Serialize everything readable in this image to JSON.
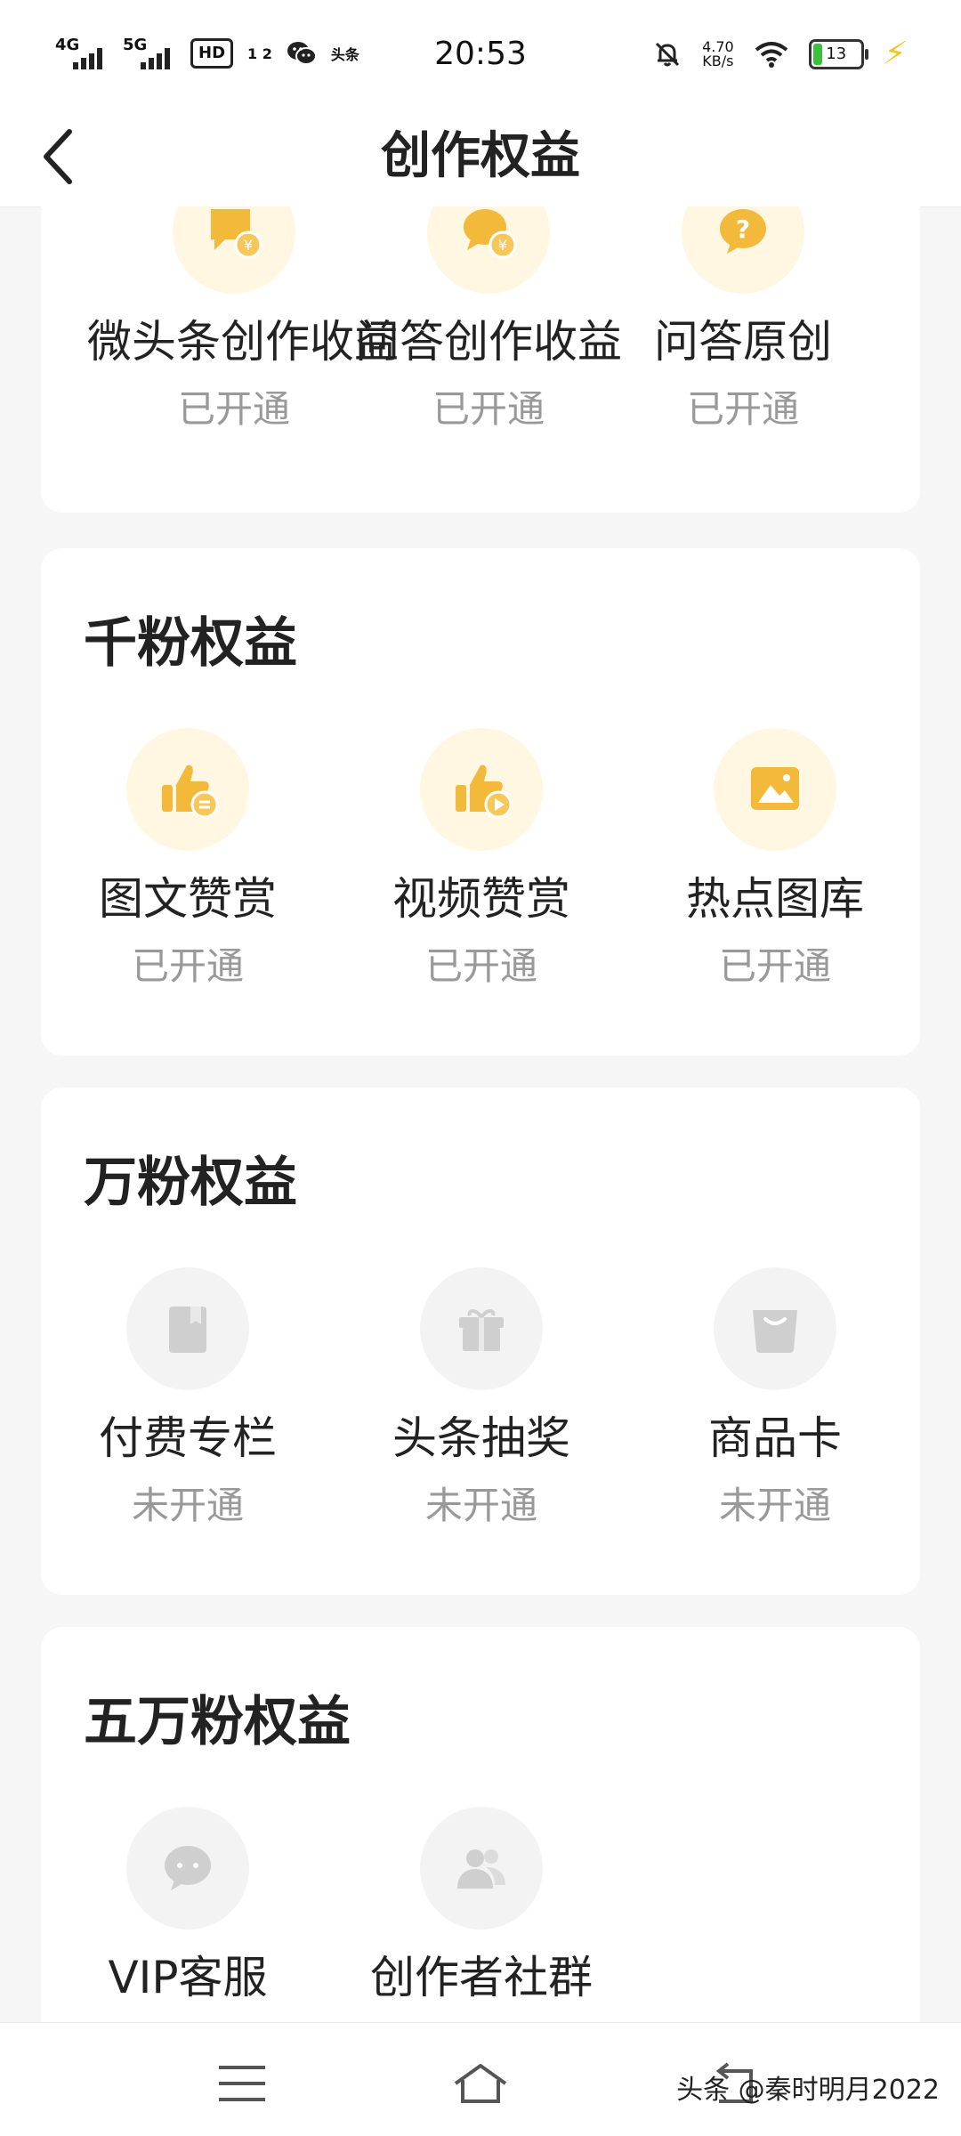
{
  "status_bar": {
    "time": "20:53",
    "net1": "4G",
    "net2": "5G",
    "hd": "HD",
    "hd_sub": "1 2",
    "app_badge": "头条",
    "speed": "4.70",
    "speed_unit": "KB/s",
    "battery": "13"
  },
  "header": {
    "title": "创作权益"
  },
  "section0": {
    "items": [
      {
        "label": "微头条创作收益",
        "status": "已开通",
        "icon": "coin-chat-icon"
      },
      {
        "label": "问答创作收益",
        "status": "已开通",
        "icon": "coin-bubble-icon"
      },
      {
        "label": "问答原创",
        "status": "已开通",
        "icon": "question-icon"
      }
    ]
  },
  "section1": {
    "title": "千粉权益",
    "items": [
      {
        "label": "图文赞赏",
        "status": "已开通",
        "icon": "thumbs-up-text-icon"
      },
      {
        "label": "视频赞赏",
        "status": "已开通",
        "icon": "thumbs-up-video-icon"
      },
      {
        "label": "热点图库",
        "status": "已开通",
        "icon": "image-library-icon"
      }
    ]
  },
  "section2": {
    "title": "万粉权益",
    "items": [
      {
        "label": "付费专栏",
        "status": "未开通",
        "icon": "book-icon"
      },
      {
        "label": "头条抽奖",
        "status": "未开通",
        "icon": "gift-box-icon"
      },
      {
        "label": "商品卡",
        "status": "未开通",
        "icon": "shopping-bag-icon"
      }
    ]
  },
  "section3": {
    "title": "五万粉权益",
    "items": [
      {
        "label": "VIP客服",
        "status": "",
        "icon": "chat-bubble-icon"
      },
      {
        "label": "创作者社群",
        "status": "",
        "icon": "community-icon"
      }
    ]
  },
  "watermark": "头条 @秦时明月2022",
  "colors": {
    "accent": "#f2b93b",
    "accent_light": "#fff7e2",
    "gray_icon": "#d0d0d0",
    "bg": "#f6f6f6"
  }
}
